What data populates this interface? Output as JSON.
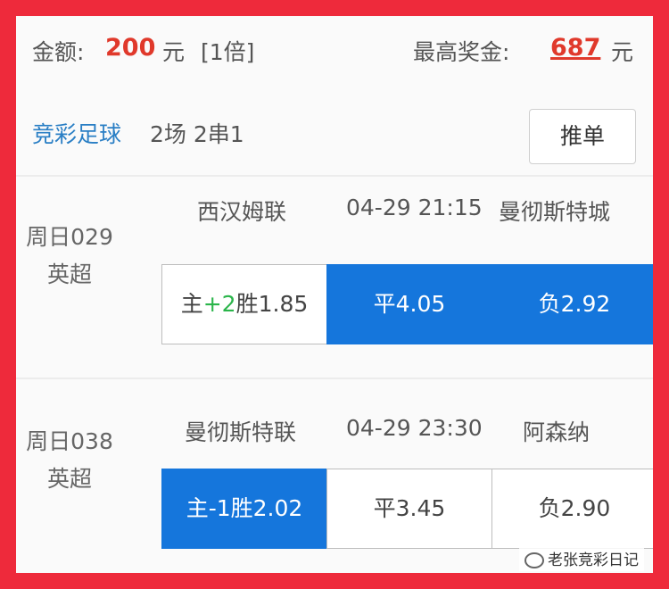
{
  "header": {
    "amount_label": "金额:",
    "amount_value": "200",
    "amount_unit": "元",
    "multiplier": "[1倍]",
    "max_prize_label": "最高奖金:",
    "max_prize_value": "687",
    "max_prize_unit": "元"
  },
  "bet_type": {
    "name": "竞彩足球",
    "info": "2场 2串1",
    "push_button": "推单"
  },
  "matches": [
    {
      "number": "周日029",
      "league": "英超",
      "home": "西汉姆联",
      "time": "04-29 21:15",
      "away": "曼彻斯特城",
      "odds": [
        {
          "prefix": "主",
          "handicap": "+2",
          "suffix": "胜1.85",
          "selected": false
        },
        {
          "label": "平4.05",
          "selected": true
        },
        {
          "label": "负2.92",
          "selected": true
        }
      ]
    },
    {
      "number": "周日038",
      "league": "英超",
      "home": "曼彻斯特联",
      "time": "04-29 23:30",
      "away": "阿森纳",
      "odds": [
        {
          "label": "主-1胜2.02",
          "selected": true
        },
        {
          "label": "平3.45",
          "selected": false
        },
        {
          "label": "负2.90",
          "selected": false
        }
      ]
    }
  ],
  "watermark": "老张竞彩日记",
  "colors": {
    "border": "#ee2a3b",
    "accent": "#1576dc",
    "price": "#e0392b",
    "link": "#2a7fc5",
    "plus": "#2bb54b"
  }
}
